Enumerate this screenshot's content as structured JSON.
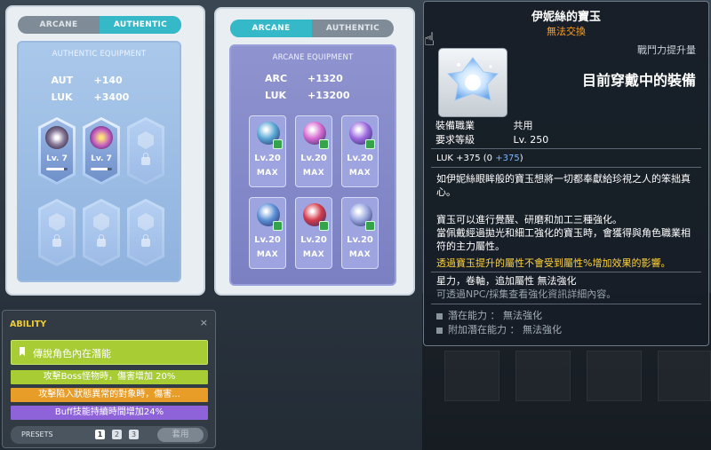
{
  "authentic_panel": {
    "tabs": [
      "ARCANE",
      "AUTHENTIC"
    ],
    "active_tab": "AUTHENTIC",
    "title": "AUTHENTIC EQUIPMENT",
    "stats": [
      {
        "name": "AUT",
        "value": "+140"
      },
      {
        "name": "LUK",
        "value": "+3400"
      }
    ],
    "slots": [
      {
        "level": "Lv. 7",
        "progress": 0.85
      },
      {
        "level": "Lv. 7",
        "progress": 0.8
      }
    ]
  },
  "arcane_panel": {
    "tabs": [
      "ARCANE",
      "AUTHENTIC"
    ],
    "active_tab": "ARCANE",
    "title": "ARCANE EQUIPMENT",
    "stats": [
      {
        "name": "ARC",
        "value": "+1320"
      },
      {
        "name": "LUK",
        "value": "+13200"
      }
    ],
    "symbols": [
      {
        "level": "Lv.20",
        "max": "MAX",
        "color": "#5aa8d6"
      },
      {
        "level": "Lv.20",
        "max": "MAX",
        "color": "#d66ad0"
      },
      {
        "level": "Lv.20",
        "max": "MAX",
        "color": "#9e6ae0"
      },
      {
        "level": "Lv.20",
        "max": "MAX",
        "color": "#5b8fd6"
      },
      {
        "level": "Lv.20",
        "max": "MAX",
        "color": "#d43b4a"
      },
      {
        "level": "Lv.20",
        "max": "MAX",
        "color": "#9aa8e0"
      }
    ]
  },
  "ability": {
    "title": "ABILITY",
    "close": "×",
    "grade": "傳說角色內在潛能",
    "lines": [
      "攻擊Boss怪物時，傷害增加 20%",
      "攻擊陷入狀態異常的對象時，傷害...",
      "Buff技能持續時間增加24%"
    ],
    "presets_label": "PRESETS",
    "preset_numbers": [
      "1",
      "2",
      "3"
    ],
    "active_preset": "1",
    "apply_button": "套用"
  },
  "tooltip": {
    "item_name": "伊妮絲的寶玉",
    "tradeable": "無法交換",
    "power_label": "戰鬥力提升量",
    "wearing_label": "目前穿戴中的裝備",
    "req_job_label": "裝備職業",
    "req_job_value": "共用",
    "req_level_label": "要求等級",
    "req_level_value": "Lv. 250",
    "stat_line_prefix": "LUK  +375  (0  ",
    "stat_line_bonus": "+375",
    "stat_line_suffix": ")",
    "desc1": "如伊妮絲眼眸般的寶玉想將一切都奉獻給珍視之人的笨拙真心。",
    "desc2": "寶玉可以進行覺醒、研磨和加工三種強化。",
    "desc3": "當佩戴經過拋光和細工強化的寶玉時，會獲得與角色職業相符的主力屬性。",
    "desc_yellow": "透過寶玉提升的屬性不會受到屬性%增加效果的影響。",
    "desc_flags": "星力，卷軸，追加屬性 無法強化",
    "desc_gray": "可透過NPC/採集查看強化資訊詳細內容。",
    "potential_1": "潛在能力 ： 無法強化",
    "potential_2": "附加潛在能力 ： 無法強化"
  },
  "icons": {
    "hand": "pointer-hand-icon",
    "grade_flag": "flag-icon",
    "lock": "lock-icon"
  }
}
